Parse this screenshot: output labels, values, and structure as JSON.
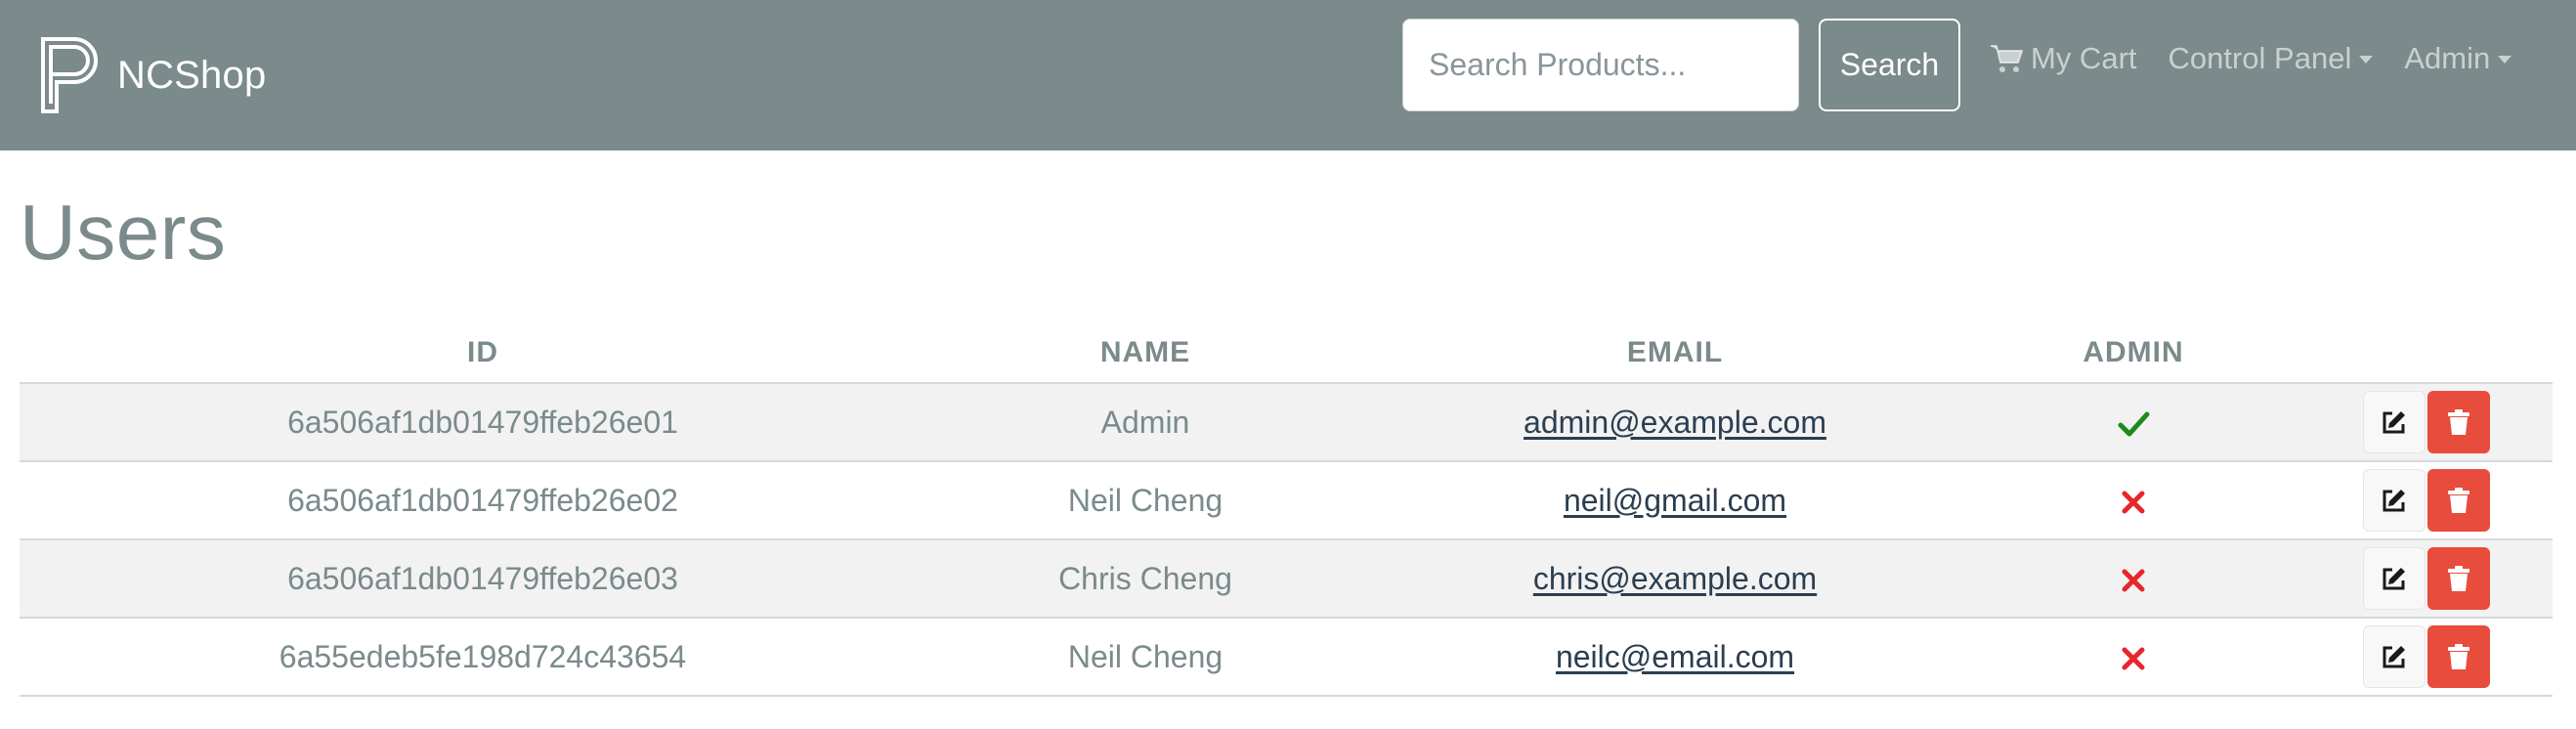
{
  "colors": {
    "navbar": "#7b8a8b",
    "link": "#2c3e50",
    "danger": "#e74c3c",
    "success": "#1e8a1e",
    "cross": "#e8252b"
  },
  "navbar": {
    "brand": "NCShop",
    "brand_icon": "p-logo-icon",
    "search_placeholder": "Search Products...",
    "search_button": "Search",
    "cart_label": "My Cart",
    "cart_icon": "shopping-cart-icon",
    "control_panel_label": "Control Panel",
    "user_menu_label": "Admin"
  },
  "page": {
    "title": "Users"
  },
  "table": {
    "headers": [
      "ID",
      "NAME",
      "EMAIL",
      "ADMIN",
      ""
    ],
    "rows": [
      {
        "id": "6a506af1db01479ffeb26e01",
        "name": "Admin",
        "email": "admin@example.com",
        "is_admin": true
      },
      {
        "id": "6a506af1db01479ffeb26e02",
        "name": "Neil Cheng",
        "email": "neil@gmail.com",
        "is_admin": false
      },
      {
        "id": "6a506af1db01479ffeb26e03",
        "name": "Chris Cheng",
        "email": "chris@example.com",
        "is_admin": false
      },
      {
        "id": "6a55edeb5fe198d724c43654",
        "name": "Neil Cheng",
        "email": "neilc@email.com",
        "is_admin": false
      }
    ],
    "edit_icon": "edit-icon",
    "delete_icon": "trash-icon"
  }
}
